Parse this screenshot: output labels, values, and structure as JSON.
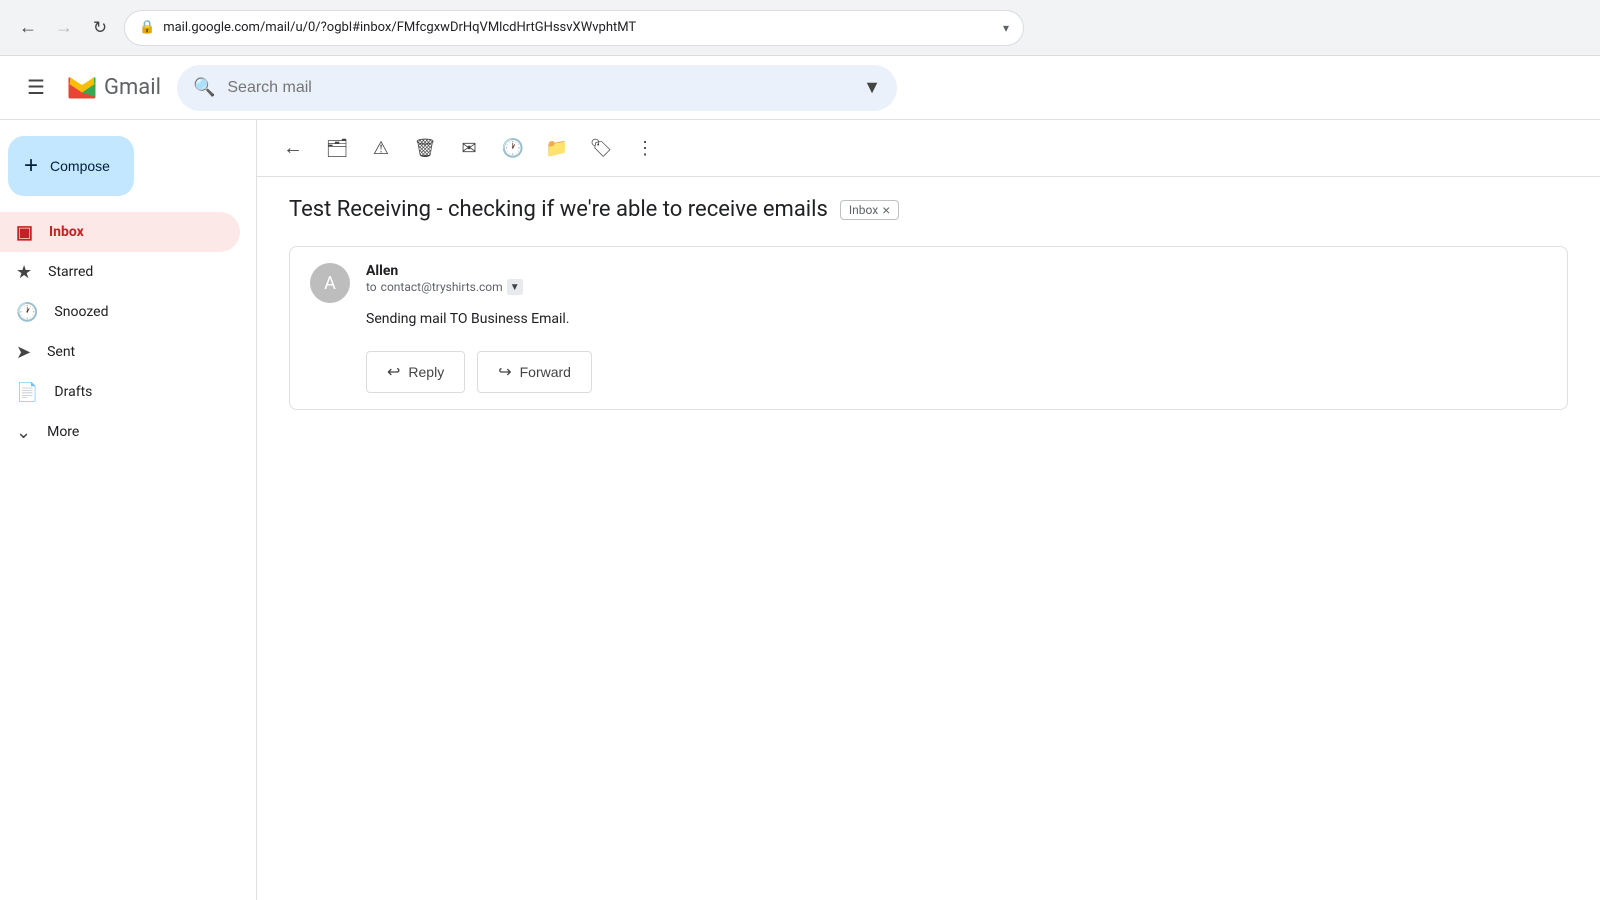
{
  "browser": {
    "back_tooltip": "Back",
    "forward_tooltip": "Forward",
    "reload_tooltip": "Reload",
    "url": "mail.google.com/mail/u/0/?ogbl#inbox/FMfcgxwDrHqVMlcdHrtGHssvXWvphtMT",
    "lock_icon": "🔒",
    "search_dropdown_icon": "▾"
  },
  "header": {
    "menu_icon": "☰",
    "gmail_logo_alt": "Gmail",
    "search_placeholder": "Search mail",
    "search_options_label": "Search options"
  },
  "sidebar": {
    "compose_label": "Compose",
    "items": [
      {
        "id": "inbox",
        "label": "Inbox",
        "active": true
      },
      {
        "id": "starred",
        "label": "Starred",
        "active": false
      },
      {
        "id": "snoozed",
        "label": "Snoozed",
        "active": false
      },
      {
        "id": "sent",
        "label": "Sent",
        "active": false
      },
      {
        "id": "drafts",
        "label": "Drafts",
        "active": false
      },
      {
        "id": "more",
        "label": "More",
        "active": false
      }
    ]
  },
  "toolbar": {
    "back_label": "Back",
    "archive_label": "Archive",
    "report_spam_label": "Report spam",
    "delete_label": "Delete",
    "mark_unread_label": "Mark as unread",
    "snooze_label": "Snooze",
    "move_label": "Move to",
    "label_label": "Label",
    "more_label": "More"
  },
  "email": {
    "subject": "Test Receiving - checking if we're able to receive emails",
    "inbox_badge": "Inbox",
    "sender_name": "Allen",
    "to_label": "to",
    "to_address": "contact@tryshirts.com",
    "body": "Sending mail TO Business Email.",
    "reply_label": "Reply",
    "forward_label": "Forward"
  }
}
